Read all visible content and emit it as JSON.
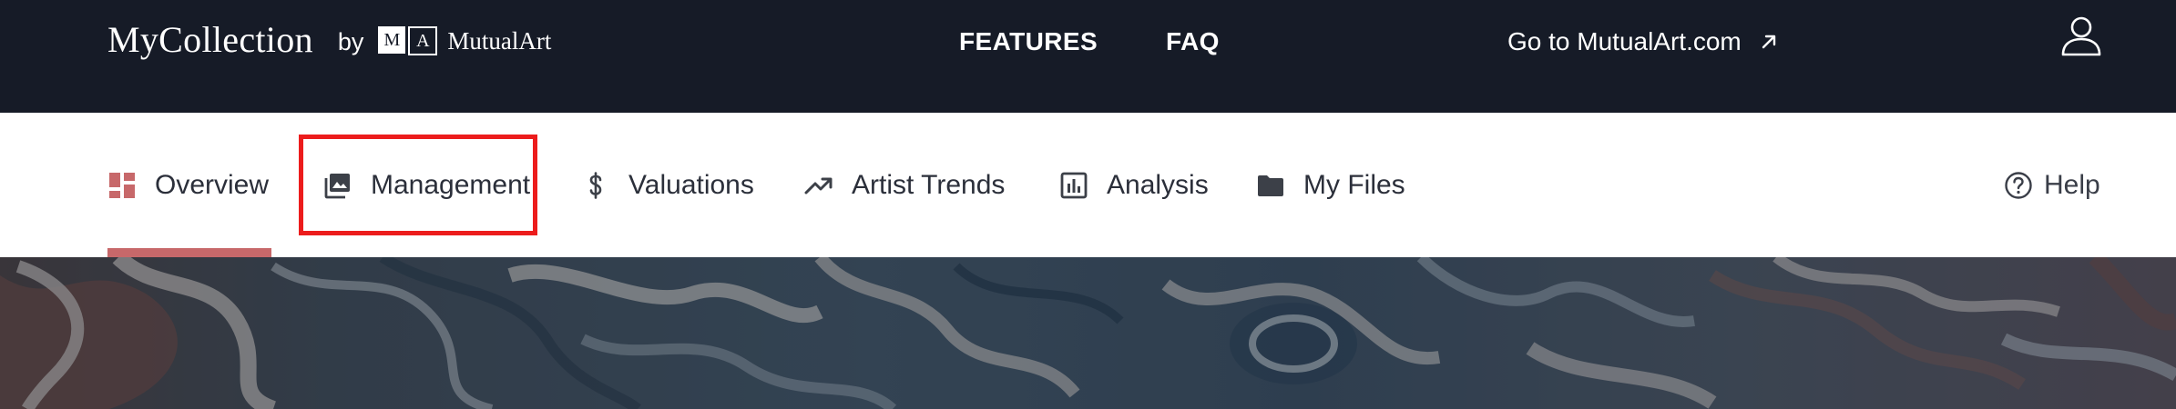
{
  "header": {
    "brand_name": "MyCollection",
    "brand_by": "by",
    "partner_logo_m": "M",
    "partner_logo_a": "A",
    "partner_name": "MutualArt",
    "nav": {
      "features": "FEATURES",
      "faq": "FAQ"
    },
    "external_link": "Go to MutualArt.com",
    "external_link_icon": "arrow-up-right-icon",
    "user_icon": "user-icon",
    "background_color": "#161b27"
  },
  "tabs": {
    "active": "Overview",
    "highlighted": "Management",
    "accent_color": "#c7686a",
    "highlight_color": "#ec1c1c",
    "items": [
      {
        "label": "Overview",
        "icon": "dashboard-icon"
      },
      {
        "label": "Management",
        "icon": "image-icon"
      },
      {
        "label": "Valuations",
        "icon": "dollar-icon"
      },
      {
        "label": "Artist Trends",
        "icon": "trending-up-icon"
      },
      {
        "label": "Analysis",
        "icon": "bar-chart-icon"
      },
      {
        "label": "My Files",
        "icon": "folder-icon"
      }
    ],
    "help_label": "Help",
    "help_icon": "question-circle-icon"
  },
  "hero": {
    "image": "marble-art-background"
  }
}
